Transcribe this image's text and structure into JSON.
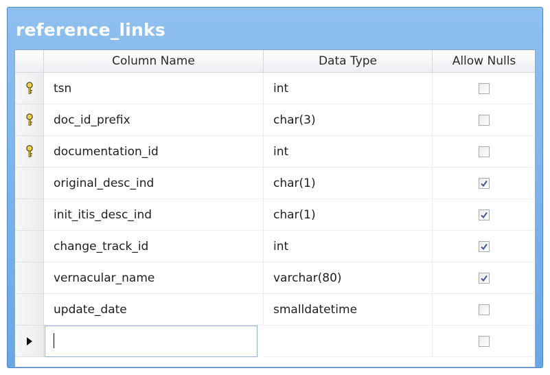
{
  "table": {
    "title": "reference_links"
  },
  "columns": {
    "name": "Column Name",
    "data_type": "Data Type",
    "allow_nulls": "Allow Nulls"
  },
  "rows": [
    {
      "name": "tsn",
      "type": "int",
      "allow_nulls": false,
      "primary_key": true
    },
    {
      "name": "doc_id_prefix",
      "type": "char(3)",
      "allow_nulls": false,
      "primary_key": true
    },
    {
      "name": "documentation_id",
      "type": "int",
      "allow_nulls": false,
      "primary_key": true
    },
    {
      "name": "original_desc_ind",
      "type": "char(1)",
      "allow_nulls": true,
      "primary_key": false
    },
    {
      "name": "init_itis_desc_ind",
      "type": "char(1)",
      "allow_nulls": true,
      "primary_key": false
    },
    {
      "name": "change_track_id",
      "type": "int",
      "allow_nulls": true,
      "primary_key": false
    },
    {
      "name": "vernacular_name",
      "type": "varchar(80)",
      "allow_nulls": true,
      "primary_key": false
    },
    {
      "name": "update_date",
      "type": "smalldatetime",
      "allow_nulls": false,
      "primary_key": false
    }
  ],
  "new_row": {
    "name": "",
    "type": "",
    "allow_nulls": false
  },
  "colors": {
    "frame": "#6aa6e4",
    "key": "#e8c81e",
    "check": "#3b5a94"
  },
  "icons": {
    "primary_key": "key-icon",
    "current_row": "current-row-arrow-icon",
    "checked": "checkmark-icon"
  }
}
